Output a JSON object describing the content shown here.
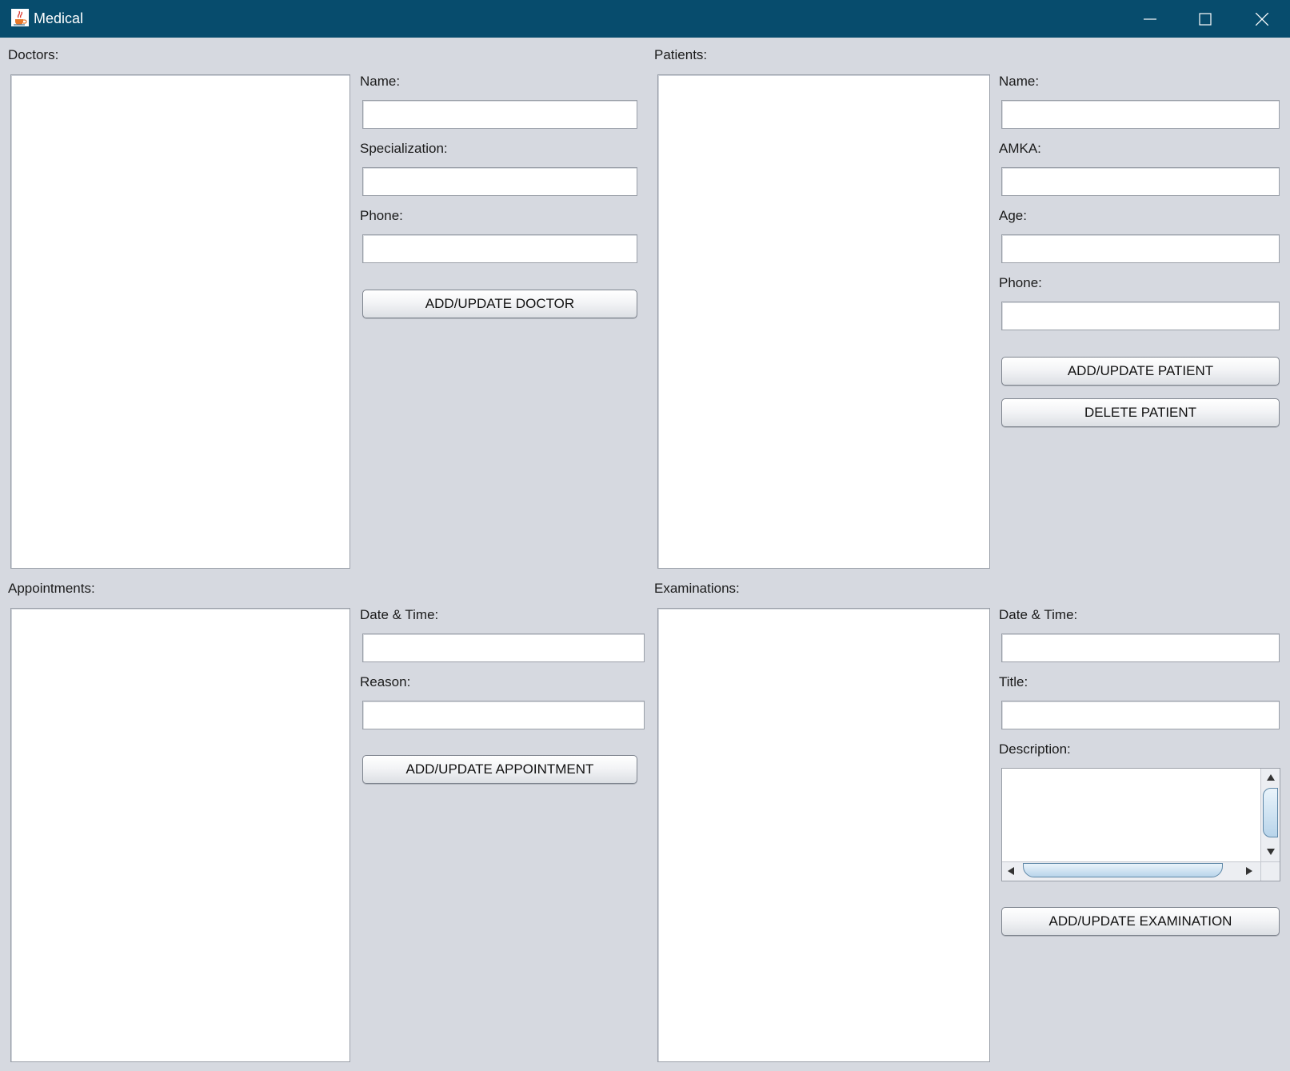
{
  "window": {
    "title": "Medical",
    "icon": "java-cup-icon",
    "controls": [
      "minimize-icon",
      "maximize-icon",
      "close-icon"
    ]
  },
  "doctors": {
    "label": "Doctors:",
    "name_label": "Name:",
    "name_value": "",
    "specialization_label": "Specialization:",
    "specialization_value": "",
    "phone_label": "Phone:",
    "phone_value": "",
    "add_button": "ADD/UPDATE DOCTOR"
  },
  "patients": {
    "label": "Patients:",
    "name_label": "Name:",
    "name_value": "",
    "amka_label": "AMKA:",
    "amka_value": "",
    "age_label": "Age:",
    "age_value": "",
    "phone_label": "Phone:",
    "phone_value": "",
    "add_button": "ADD/UPDATE PATIENT",
    "delete_button": "DELETE PATIENT"
  },
  "appointments": {
    "label": "Appointments:",
    "datetime_label": "Date & Time:",
    "datetime_value": "",
    "reason_label": "Reason:",
    "reason_value": "",
    "add_button": "ADD/UPDATE APPOINTMENT"
  },
  "examinations": {
    "label": "Examinations:",
    "datetime_label": "Date & Time:",
    "datetime_value": "",
    "title_label": "Title:",
    "title_value": "",
    "description_label": "Description:",
    "description_value": "",
    "add_button": "ADD/UPDATE EXAMINATION"
  }
}
